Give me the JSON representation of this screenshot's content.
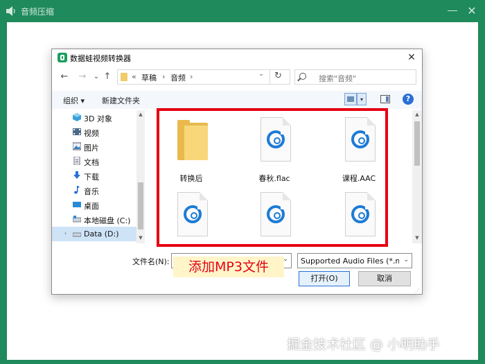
{
  "app": {
    "title": "音频压缩",
    "icon": "speaker-icon",
    "close_label": "✕"
  },
  "dialog": {
    "title": "数据蛙视频转换器",
    "close_label": "✕",
    "nav": {
      "back": "←",
      "forward": "→",
      "recent": "⌄",
      "up": "↑"
    },
    "breadcrumb": {
      "prefix": "«",
      "items": [
        "草稿",
        "音频"
      ]
    },
    "refresh_label": "↻",
    "search_placeholder": "搜索\"音频\"",
    "commands": {
      "organize": "组织 ▾",
      "new_folder": "新建文件夹"
    },
    "help_label": "?",
    "sidebar": {
      "items": [
        {
          "label": "3D 对象",
          "icon": "3d-objects-icon"
        },
        {
          "label": "视频",
          "icon": "video-icon"
        },
        {
          "label": "图片",
          "icon": "pictures-icon"
        },
        {
          "label": "文档",
          "icon": "documents-icon"
        },
        {
          "label": "下载",
          "icon": "downloads-icon"
        },
        {
          "label": "音乐",
          "icon": "music-icon"
        },
        {
          "label": "桌面",
          "icon": "desktop-icon"
        },
        {
          "label": "本地磁盘 (C:)",
          "icon": "drive-icon"
        },
        {
          "label": "Data (D:)",
          "icon": "drive-icon",
          "selected": true
        }
      ]
    },
    "files": [
      {
        "name": "转换后",
        "type": "folder"
      },
      {
        "name": "春秋.flac",
        "type": "audio"
      },
      {
        "name": "课程.AAC",
        "type": "audio"
      },
      {
        "name": "",
        "type": "audio"
      },
      {
        "name": "",
        "type": "audio"
      },
      {
        "name": "",
        "type": "audio"
      }
    ],
    "filename_label": "文件名(N):",
    "filename_value": "",
    "filetype_value": "Supported Audio Files (*.mp",
    "open_label": "打开(O)",
    "cancel_label": "取消"
  },
  "annotation": "添加MP3文件",
  "watermark": "掘金技术社区 @ 小明助手",
  "colors": {
    "accent_green": "#1f8a5b",
    "highlight_red": "#e60012",
    "annotation_bg": "#fff5c9",
    "audio_blue": "#1d7bd6"
  }
}
